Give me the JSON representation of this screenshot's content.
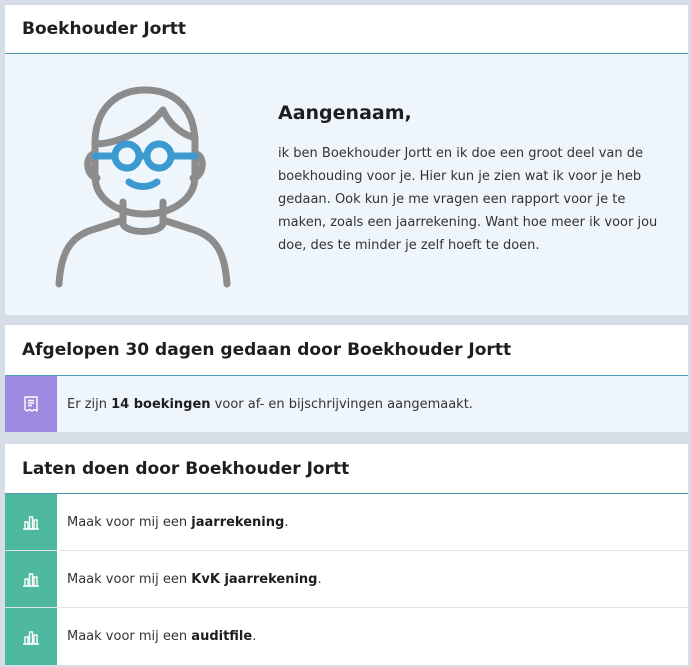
{
  "intro": {
    "header": "Boekhouder Jortt",
    "greeting": "Aangenaam,",
    "paragraph": "ik ben Boekhouder Jortt en ik doe een groot deel van de boekhouding voor je. Hier kun je zien wat ik voor je heb gedaan. Ook kun je me vragen een rapport voor je te maken, zoals een jaarrekening. Want hoe meer ik voor jou doe, des te minder je zelf hoeft te doen.",
    "avatar_icon": "bookkeeper-avatar-icon"
  },
  "done": {
    "header": "Afgelopen 30 dagen gedaan door Boekhouder Jortt",
    "items": [
      {
        "icon": "receipt-icon",
        "prefix": "Er zijn ",
        "bold": "14 boekingen",
        "suffix": " voor af- en bijschrijvingen aangemaakt."
      }
    ]
  },
  "todo": {
    "header": "Laten doen door Boekhouder Jortt",
    "items": [
      {
        "icon": "bar-chart-icon",
        "prefix": "Maak voor mij een ",
        "bold": "jaarrekening",
        "suffix": "."
      },
      {
        "icon": "bar-chart-icon",
        "prefix": "Maak voor mij een ",
        "bold": "KvK jaarrekening",
        "suffix": "."
      },
      {
        "icon": "bar-chart-icon",
        "prefix": "Maak voor mij een ",
        "bold": "auditfile",
        "suffix": "."
      }
    ]
  },
  "colors": {
    "accent_line": "#4d9fb8",
    "info_background": "#eef6fc",
    "done_icon_bg": "#9b8ae0",
    "todo_icon_bg": "#4fb9a0",
    "avatar_glasses": "#3d9ad1",
    "avatar_outline": "#8c8c8c"
  }
}
